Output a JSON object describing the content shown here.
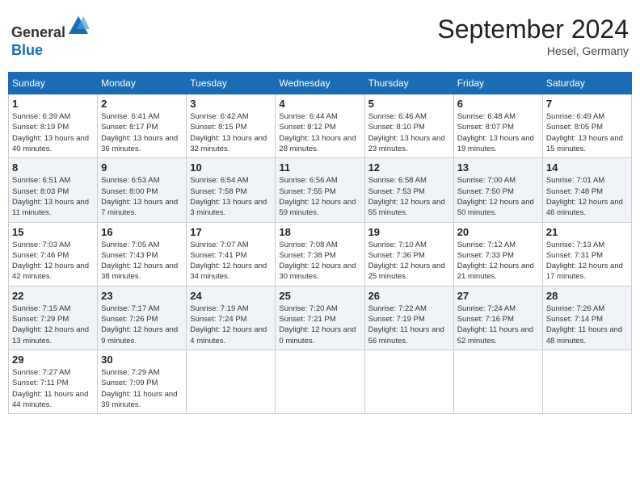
{
  "header": {
    "logo_line1": "General",
    "logo_line2": "Blue",
    "month": "September 2024",
    "location": "Hesel, Germany"
  },
  "weekdays": [
    "Sunday",
    "Monday",
    "Tuesday",
    "Wednesday",
    "Thursday",
    "Friday",
    "Saturday"
  ],
  "weeks": [
    [
      {
        "day": "1",
        "sunrise": "Sunrise: 6:39 AM",
        "sunset": "Sunset: 8:19 PM",
        "daylight": "Daylight: 13 hours and 40 minutes."
      },
      {
        "day": "2",
        "sunrise": "Sunrise: 6:41 AM",
        "sunset": "Sunset: 8:17 PM",
        "daylight": "Daylight: 13 hours and 36 minutes."
      },
      {
        "day": "3",
        "sunrise": "Sunrise: 6:42 AM",
        "sunset": "Sunset: 8:15 PM",
        "daylight": "Daylight: 13 hours and 32 minutes."
      },
      {
        "day": "4",
        "sunrise": "Sunrise: 6:44 AM",
        "sunset": "Sunset: 8:12 PM",
        "daylight": "Daylight: 13 hours and 28 minutes."
      },
      {
        "day": "5",
        "sunrise": "Sunrise: 6:46 AM",
        "sunset": "Sunset: 8:10 PM",
        "daylight": "Daylight: 13 hours and 23 minutes."
      },
      {
        "day": "6",
        "sunrise": "Sunrise: 6:48 AM",
        "sunset": "Sunset: 8:07 PM",
        "daylight": "Daylight: 13 hours and 19 minutes."
      },
      {
        "day": "7",
        "sunrise": "Sunrise: 6:49 AM",
        "sunset": "Sunset: 8:05 PM",
        "daylight": "Daylight: 13 hours and 15 minutes."
      }
    ],
    [
      {
        "day": "8",
        "sunrise": "Sunrise: 6:51 AM",
        "sunset": "Sunset: 8:03 PM",
        "daylight": "Daylight: 13 hours and 11 minutes."
      },
      {
        "day": "9",
        "sunrise": "Sunrise: 6:53 AM",
        "sunset": "Sunset: 8:00 PM",
        "daylight": "Daylight: 13 hours and 7 minutes."
      },
      {
        "day": "10",
        "sunrise": "Sunrise: 6:54 AM",
        "sunset": "Sunset: 7:58 PM",
        "daylight": "Daylight: 13 hours and 3 minutes."
      },
      {
        "day": "11",
        "sunrise": "Sunrise: 6:56 AM",
        "sunset": "Sunset: 7:55 PM",
        "daylight": "Daylight: 12 hours and 59 minutes."
      },
      {
        "day": "12",
        "sunrise": "Sunrise: 6:58 AM",
        "sunset": "Sunset: 7:53 PM",
        "daylight": "Daylight: 12 hours and 55 minutes."
      },
      {
        "day": "13",
        "sunrise": "Sunrise: 7:00 AM",
        "sunset": "Sunset: 7:50 PM",
        "daylight": "Daylight: 12 hours and 50 minutes."
      },
      {
        "day": "14",
        "sunrise": "Sunrise: 7:01 AM",
        "sunset": "Sunset: 7:48 PM",
        "daylight": "Daylight: 12 hours and 46 minutes."
      }
    ],
    [
      {
        "day": "15",
        "sunrise": "Sunrise: 7:03 AM",
        "sunset": "Sunset: 7:46 PM",
        "daylight": "Daylight: 12 hours and 42 minutes."
      },
      {
        "day": "16",
        "sunrise": "Sunrise: 7:05 AM",
        "sunset": "Sunset: 7:43 PM",
        "daylight": "Daylight: 12 hours and 38 minutes."
      },
      {
        "day": "17",
        "sunrise": "Sunrise: 7:07 AM",
        "sunset": "Sunset: 7:41 PM",
        "daylight": "Daylight: 12 hours and 34 minutes."
      },
      {
        "day": "18",
        "sunrise": "Sunrise: 7:08 AM",
        "sunset": "Sunset: 7:38 PM",
        "daylight": "Daylight: 12 hours and 30 minutes."
      },
      {
        "day": "19",
        "sunrise": "Sunrise: 7:10 AM",
        "sunset": "Sunset: 7:36 PM",
        "daylight": "Daylight: 12 hours and 25 minutes."
      },
      {
        "day": "20",
        "sunrise": "Sunrise: 7:12 AM",
        "sunset": "Sunset: 7:33 PM",
        "daylight": "Daylight: 12 hours and 21 minutes."
      },
      {
        "day": "21",
        "sunrise": "Sunrise: 7:13 AM",
        "sunset": "Sunset: 7:31 PM",
        "daylight": "Daylight: 12 hours and 17 minutes."
      }
    ],
    [
      {
        "day": "22",
        "sunrise": "Sunrise: 7:15 AM",
        "sunset": "Sunset: 7:29 PM",
        "daylight": "Daylight: 12 hours and 13 minutes."
      },
      {
        "day": "23",
        "sunrise": "Sunrise: 7:17 AM",
        "sunset": "Sunset: 7:26 PM",
        "daylight": "Daylight: 12 hours and 9 minutes."
      },
      {
        "day": "24",
        "sunrise": "Sunrise: 7:19 AM",
        "sunset": "Sunset: 7:24 PM",
        "daylight": "Daylight: 12 hours and 4 minutes."
      },
      {
        "day": "25",
        "sunrise": "Sunrise: 7:20 AM",
        "sunset": "Sunset: 7:21 PM",
        "daylight": "Daylight: 12 hours and 0 minutes."
      },
      {
        "day": "26",
        "sunrise": "Sunrise: 7:22 AM",
        "sunset": "Sunset: 7:19 PM",
        "daylight": "Daylight: 11 hours and 56 minutes."
      },
      {
        "day": "27",
        "sunrise": "Sunrise: 7:24 AM",
        "sunset": "Sunset: 7:16 PM",
        "daylight": "Daylight: 11 hours and 52 minutes."
      },
      {
        "day": "28",
        "sunrise": "Sunrise: 7:26 AM",
        "sunset": "Sunset: 7:14 PM",
        "daylight": "Daylight: 11 hours and 48 minutes."
      }
    ],
    [
      {
        "day": "29",
        "sunrise": "Sunrise: 7:27 AM",
        "sunset": "Sunset: 7:11 PM",
        "daylight": "Daylight: 11 hours and 44 minutes."
      },
      {
        "day": "30",
        "sunrise": "Sunrise: 7:29 AM",
        "sunset": "Sunset: 7:09 PM",
        "daylight": "Daylight: 11 hours and 39 minutes."
      },
      null,
      null,
      null,
      null,
      null
    ]
  ]
}
